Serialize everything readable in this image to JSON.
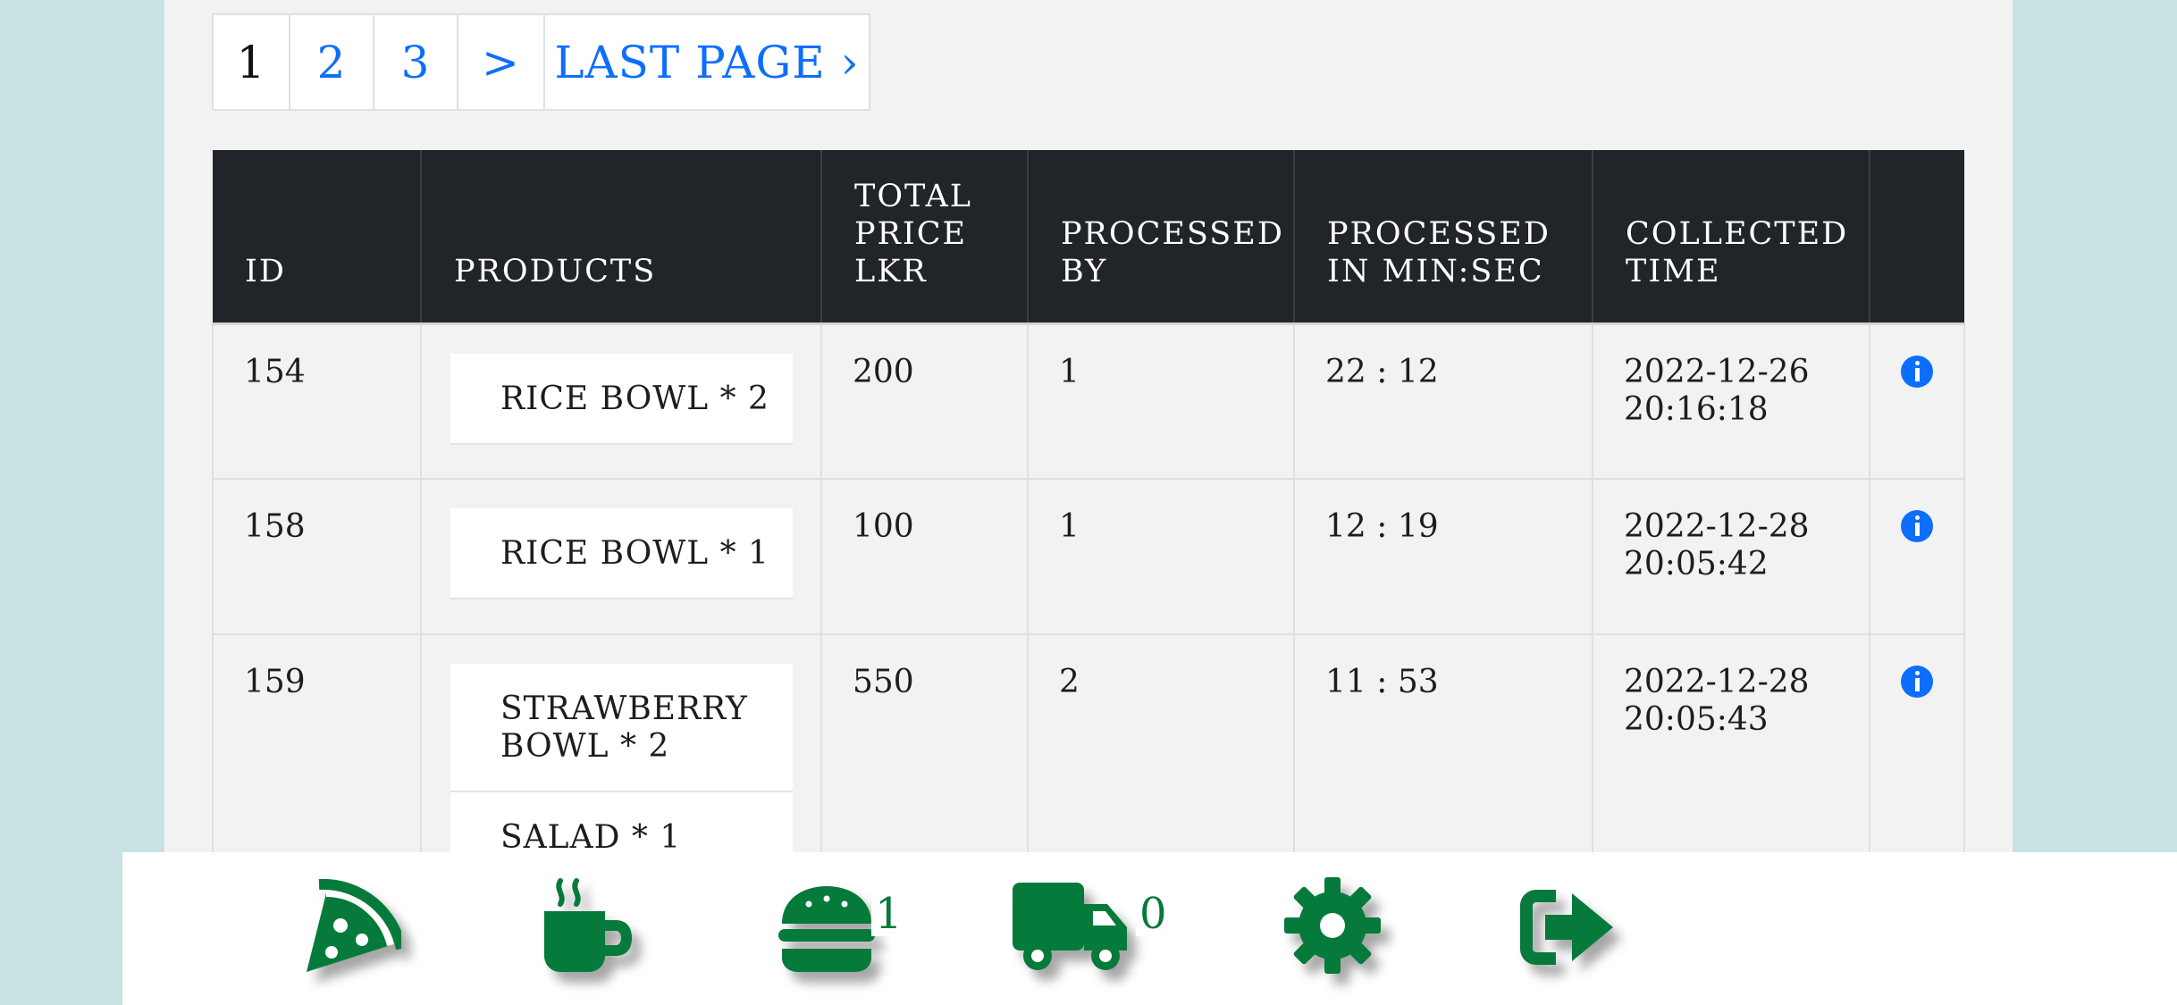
{
  "pagination": {
    "pages": [
      "1",
      "2",
      "3"
    ],
    "active": "1",
    "next_label": ">",
    "last_label": "LAST PAGE ›"
  },
  "table": {
    "headers": [
      "ID",
      "PRODUCTS",
      "TOTAL PRICE LKR",
      "PROCESSED BY",
      "PROCESSED IN MIN:SEC",
      "COLLECTED TIME",
      ""
    ],
    "rows": [
      {
        "id": "154",
        "products": [
          "RICE BOWL * 2"
        ],
        "total": "200",
        "processed_by": "1",
        "processed_time": "22 : 12",
        "collected_date": "2022-12-26",
        "collected_time": "20:16:18"
      },
      {
        "id": "158",
        "products": [
          "RICE BOWL * 1"
        ],
        "total": "100",
        "processed_by": "1",
        "processed_time": "12 : 19",
        "collected_date": "2022-12-28",
        "collected_time": "20:05:42"
      },
      {
        "id": "159",
        "products": [
          "STRAWBERRY BOWL * 2",
          "SALAD * 1"
        ],
        "total": "550",
        "processed_by": "2",
        "processed_time": "11 : 53",
        "collected_date": "2022-12-28",
        "collected_time": "20:05:43"
      }
    ]
  },
  "bottom_nav": {
    "items": [
      {
        "icon": "pizza-slice-icon"
      },
      {
        "icon": "coffee-cup-icon"
      },
      {
        "icon": "burger-icon",
        "badge": "1"
      },
      {
        "icon": "delivery-truck-icon",
        "badge": "0"
      },
      {
        "icon": "gear-icon"
      },
      {
        "icon": "sign-out-icon"
      }
    ]
  },
  "colors": {
    "accent_green": "#067a3b",
    "link_blue": "#0d6efd",
    "table_header_bg": "#212529",
    "page_bg": "#c9e3e5",
    "panel_bg": "#f2f2f2"
  }
}
